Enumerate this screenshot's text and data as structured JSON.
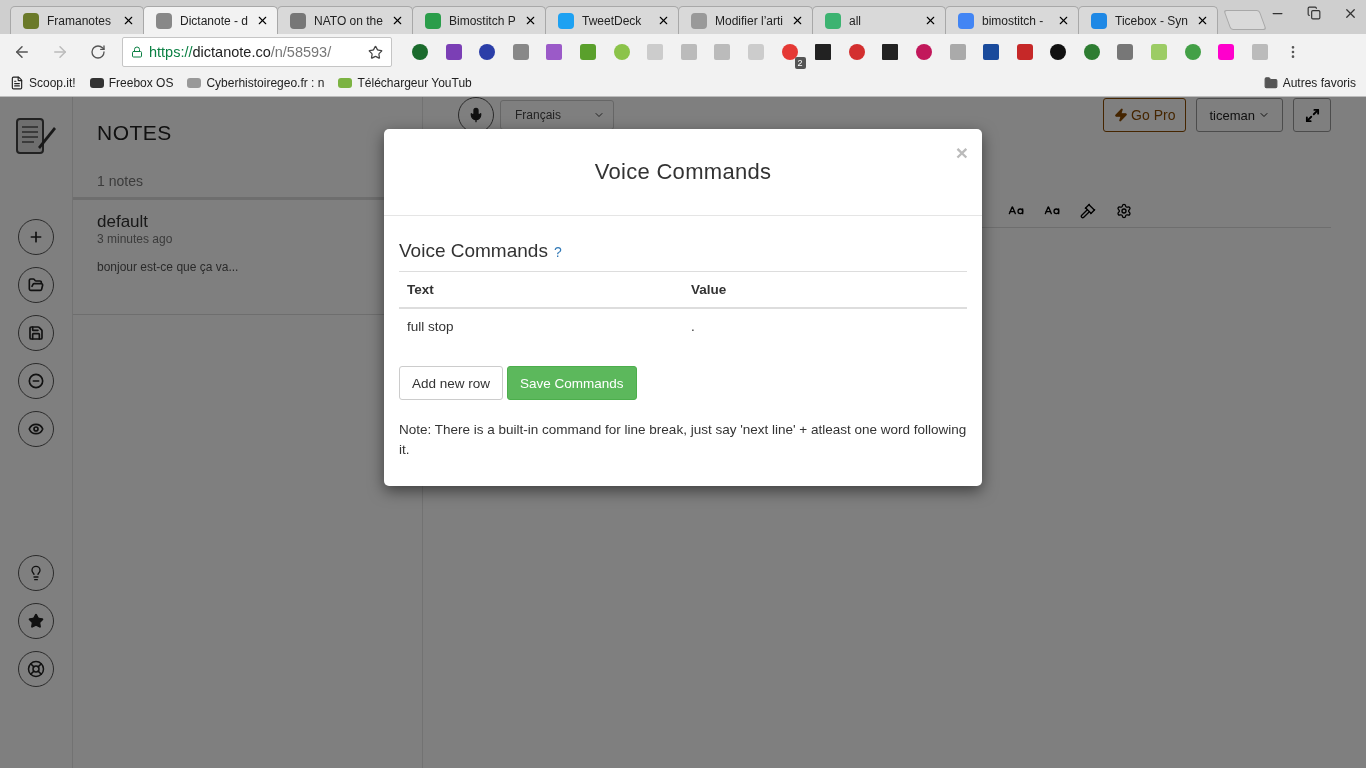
{
  "browser": {
    "tabs": [
      {
        "title": "Framanotes",
        "selected": false
      },
      {
        "title": "Dictanote - d",
        "selected": true
      },
      {
        "title": "NATO on the",
        "selected": false
      },
      {
        "title": "Bimostitch P",
        "selected": false
      },
      {
        "title": "TweetDeck",
        "selected": false
      },
      {
        "title": "Modifier l’arti",
        "selected": false
      },
      {
        "title": "all",
        "selected": false
      },
      {
        "title": "bimostitch - ",
        "selected": false
      },
      {
        "title": "Ticebox - Syn",
        "selected": false
      }
    ],
    "address": {
      "scheme": "https://",
      "domain": "dictanote.co",
      "path": "/n/58593/"
    },
    "extension_badge": "2",
    "bookmarks": [
      "Scoop.it!",
      "Freebox OS",
      "Cyberhistoiregeo.fr : n",
      "Téléchargeur YouTub"
    ],
    "other_bookmarks": "Autres favoris"
  },
  "app": {
    "notes_title": "NOTES",
    "notes_count": "1 notes",
    "notes": [
      {
        "title": "default",
        "time": "3 minutes ago",
        "preview": "bonjour est-ce que ça va..."
      }
    ],
    "language": "Français",
    "go_pro": "Go Pro",
    "user": "ticeman"
  },
  "modal": {
    "title": "Voice Commands",
    "close": "×",
    "heading": "Voice Commands",
    "help": "?",
    "columns": [
      "Text",
      "Value"
    ],
    "rows": [
      [
        "full stop",
        "."
      ]
    ],
    "buttons": [
      {
        "label": "Add new row",
        "kind": "default"
      },
      {
        "label": "Save Commands",
        "kind": "primary"
      }
    ],
    "note": "Note: There is a built-in command for line break, just say 'next line' + atleast one word following it."
  }
}
